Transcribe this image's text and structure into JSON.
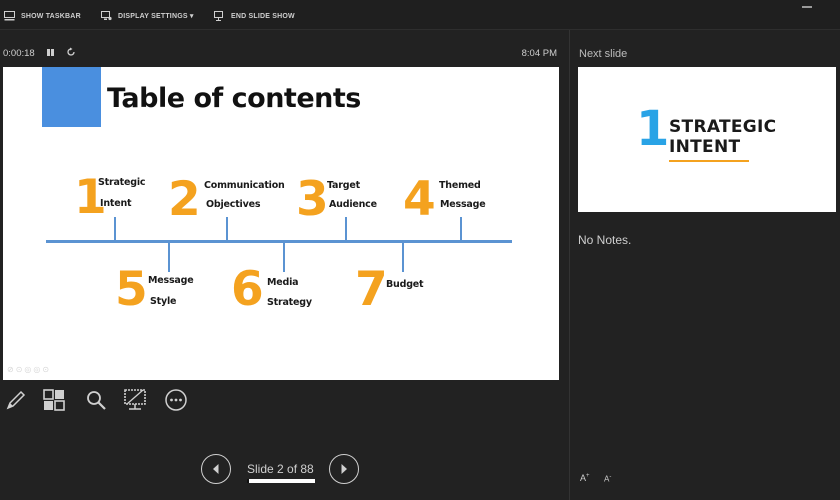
{
  "toolbar": {
    "show_taskbar": "SHOW TASKBAR",
    "display_settings": "DISPLAY SETTINGS ▾",
    "end_slide_show": "END SLIDE SHOW"
  },
  "presenter": {
    "timer": "0:00:18",
    "clock": "8:04 PM"
  },
  "current_slide": {
    "title": "Table of contents",
    "items": [
      {
        "number": "1",
        "line1": "Strategic",
        "line2": "Intent"
      },
      {
        "number": "2",
        "line1": "Communication",
        "line2": "Objectives"
      },
      {
        "number": "3",
        "line1": "Target",
        "line2": "Audience"
      },
      {
        "number": "4",
        "line1": "Themed",
        "line2": "Message"
      },
      {
        "number": "5",
        "line1": "Message",
        "line2": "Style"
      },
      {
        "number": "6",
        "line1": "Media",
        "line2": "Strategy"
      },
      {
        "number": "7",
        "line1": "Budget",
        "line2": ""
      }
    ],
    "accent_color": "#f4a21f",
    "block_color": "#4a8fdf",
    "timeline_color": "#5b93d2"
  },
  "tools": [
    "pen-icon",
    "see-all-slides-icon",
    "zoom-icon",
    "black-screen-icon",
    "more-options-icon"
  ],
  "navigation": {
    "counter": "Slide 2 of 88",
    "progress": 0.023
  },
  "next_slide": {
    "label": "Next slide",
    "number": "1",
    "line1": "STRATEGIC",
    "line2": "INTENT",
    "number_color": "#29a3e6"
  },
  "notes": {
    "text": "No Notes.",
    "increase_font": "A",
    "decrease_font": "A"
  }
}
